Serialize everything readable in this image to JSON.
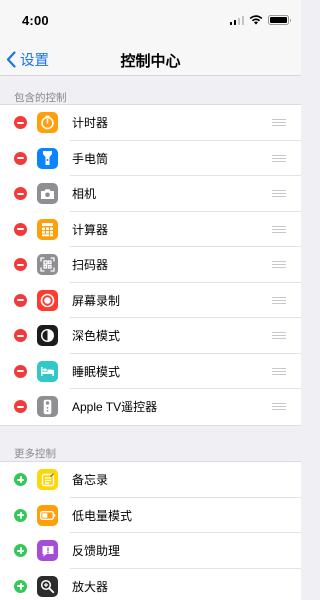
{
  "status_bar": {
    "time": "4:00"
  },
  "nav": {
    "back_label": "设置",
    "title": "控制中心"
  },
  "included": {
    "header": "包含的控制",
    "items": [
      {
        "label": "计时器",
        "icon": "timer-icon",
        "color": "#ff9f0a"
      },
      {
        "label": "手电筒",
        "icon": "flashlight-icon",
        "color": "#0a84ff"
      },
      {
        "label": "相机",
        "icon": "camera-icon",
        "color": "#8e8e93"
      },
      {
        "label": "计算器",
        "icon": "calculator-icon",
        "color": "#ff9f0a"
      },
      {
        "label": "扫码器",
        "icon": "qr-scanner-icon",
        "color": "#8e8e93"
      },
      {
        "label": "屏幕录制",
        "icon": "screen-recording-icon",
        "color": "#ff3b30"
      },
      {
        "label": "深色模式",
        "icon": "dark-mode-icon",
        "color": "#1c1c1e"
      },
      {
        "label": "睡眠模式",
        "icon": "sleep-mode-icon",
        "color": "#30c8c8"
      },
      {
        "label": "Apple TV遥控器",
        "icon": "apple-tv-remote-icon",
        "color": "#8e8e93"
      }
    ]
  },
  "more": {
    "header": "更多控制",
    "items": [
      {
        "label": "备忘录",
        "icon": "notes-icon",
        "color": "#ffd60a"
      },
      {
        "label": "低电量模式",
        "icon": "low-power-mode-icon",
        "color": "#ff9f0a"
      },
      {
        "label": "反馈助理",
        "icon": "feedback-assistant-icon",
        "color": "#a64dd8"
      },
      {
        "label": "放大器",
        "icon": "magnifier-icon",
        "color": "#2c2c2e"
      }
    ]
  }
}
